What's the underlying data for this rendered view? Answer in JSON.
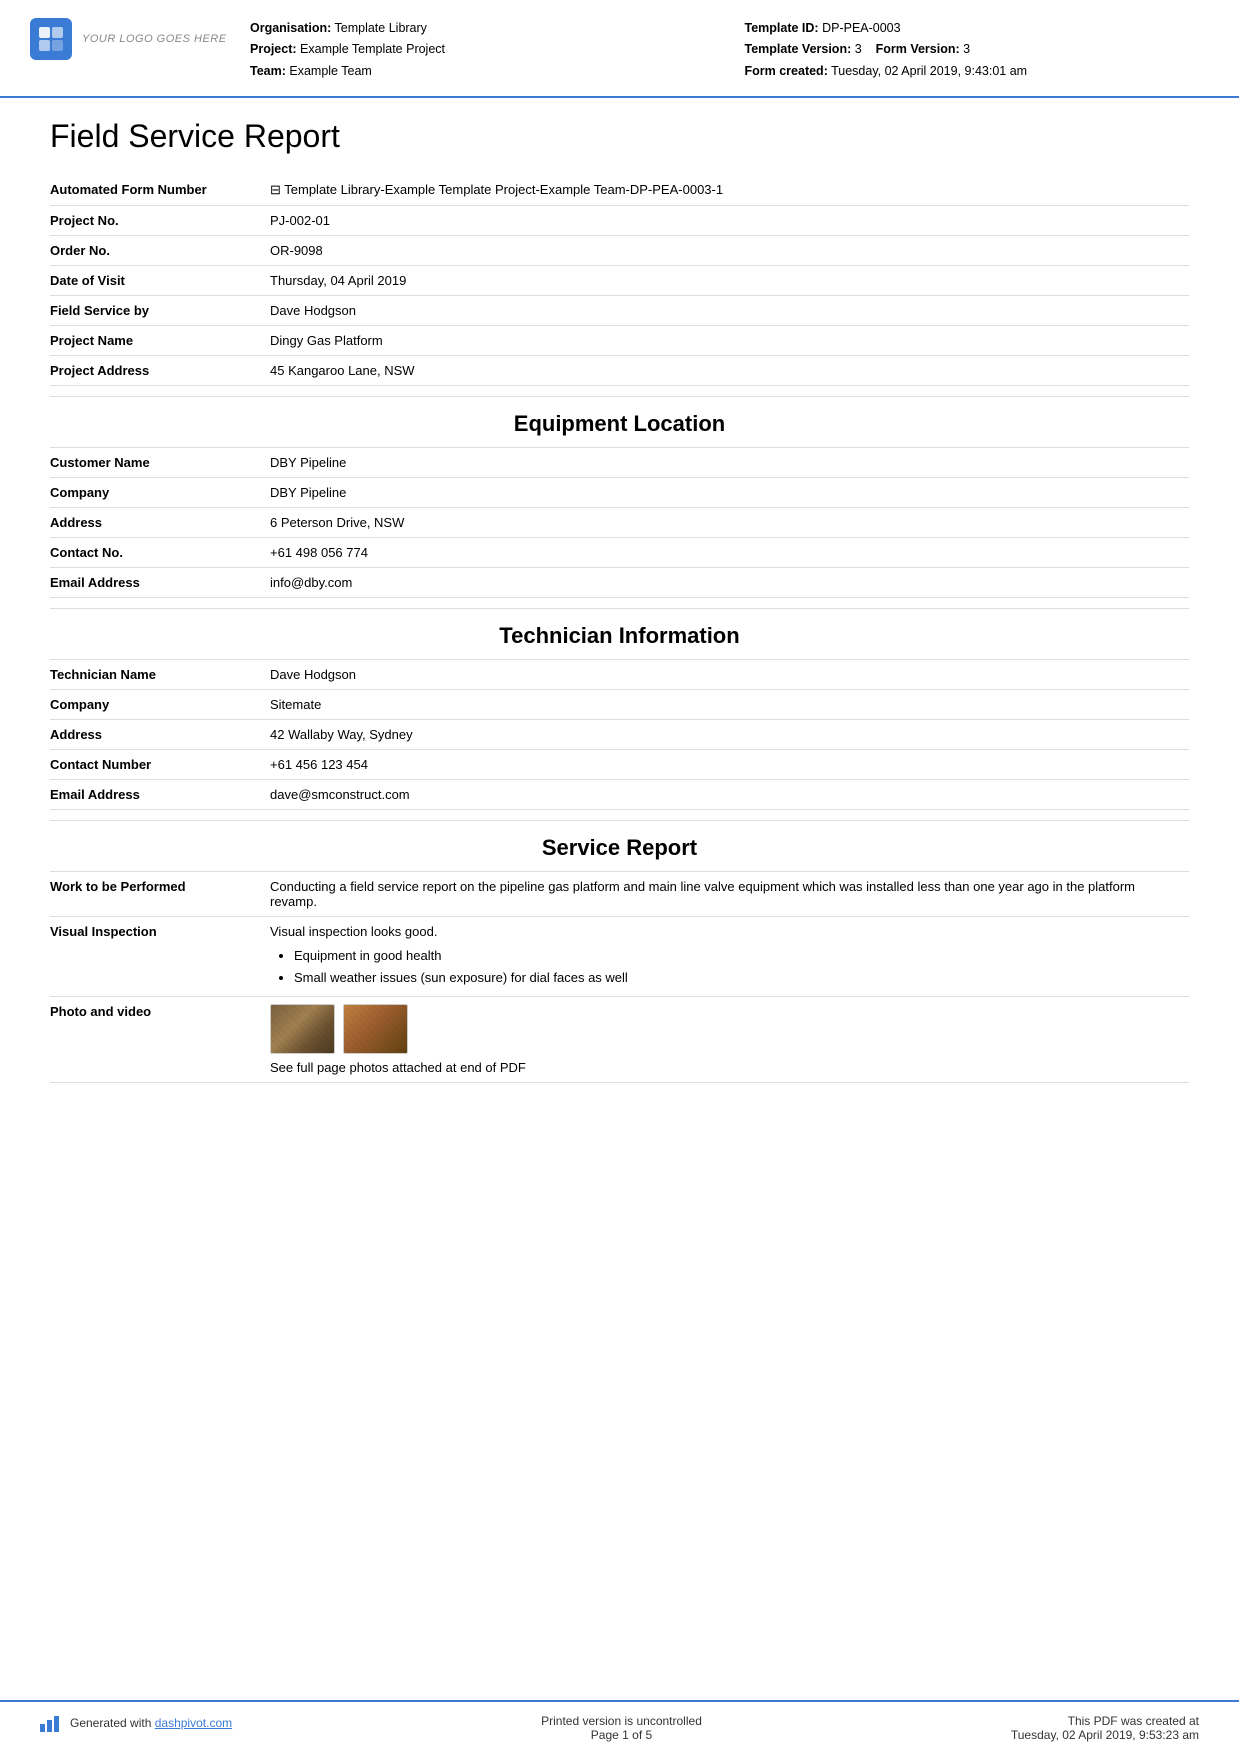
{
  "header": {
    "logo_text": "YOUR LOGO GOES HERE",
    "organisation_label": "Organisation:",
    "organisation_value": "Template Library",
    "project_label": "Project:",
    "project_value": "Example Template Project",
    "team_label": "Team:",
    "team_value": "Example Team",
    "template_id_label": "Template ID:",
    "template_id_value": "DP-PEA-0003",
    "template_version_label": "Template Version:",
    "template_version_value": "3",
    "form_version_label": "Form Version:",
    "form_version_value": "3",
    "form_created_label": "Form created:",
    "form_created_value": "Tuesday, 02 April 2019, 9:43:01 am"
  },
  "page_title": "Field Service Report",
  "form_fields": [
    {
      "label": "Automated Form Number",
      "value": "⊟ Template Library-Example Template Project-Example Team-DP-PEA-0003-1"
    },
    {
      "label": "Project No.",
      "value": "PJ-002-01"
    },
    {
      "label": "Order No.",
      "value": "OR-9098"
    },
    {
      "label": "Date of Visit",
      "value": "Thursday, 04 April 2019"
    },
    {
      "label": "Field Service by",
      "value": "Dave Hodgson"
    },
    {
      "label": "Project Name",
      "value": "Dingy Gas Platform"
    },
    {
      "label": "Project Address",
      "value": "45 Kangaroo Lane, NSW"
    }
  ],
  "equipment_location": {
    "heading": "Equipment Location",
    "fields": [
      {
        "label": "Customer Name",
        "value": "DBY Pipeline"
      },
      {
        "label": "Company",
        "value": "DBY Pipeline"
      },
      {
        "label": "Address",
        "value": "6 Peterson Drive, NSW"
      },
      {
        "label": "Contact No.",
        "value": "+61 498 056 774"
      },
      {
        "label": "Email Address",
        "value": "info@dby.com"
      }
    ]
  },
  "technician_info": {
    "heading": "Technician Information",
    "fields": [
      {
        "label": "Technician Name",
        "value": "Dave Hodgson"
      },
      {
        "label": "Company",
        "value": "Sitemate"
      },
      {
        "label": "Address",
        "value": "42 Wallaby Way, Sydney"
      },
      {
        "label": "Contact Number",
        "value": "+61 456 123 454"
      },
      {
        "label": "Email Address",
        "value": "dave@smconstruct.com"
      }
    ]
  },
  "service_report": {
    "heading": "Service Report",
    "fields": [
      {
        "label": "Work to be Performed",
        "value": "Conducting a field service report on the pipeline gas platform and main line valve equipment which was installed less than one year ago in the platform revamp."
      },
      {
        "label": "Visual Inspection",
        "intro": "Visual inspection looks good.",
        "bullets": [
          "Equipment in good health",
          "Small weather issues (sun exposure) for dial faces as well"
        ]
      },
      {
        "label": "Photo and video",
        "photo_caption": "See full page photos attached at end of PDF"
      }
    ]
  },
  "footer": {
    "generated_with": "Generated with",
    "dashpivot_link": "dashpivot.com",
    "printed_version": "Printed version is uncontrolled",
    "page_of": "Page 1 of 5",
    "pdf_created": "This PDF was created at",
    "pdf_created_date": "Tuesday, 02 April 2019, 9:53:23 am"
  }
}
